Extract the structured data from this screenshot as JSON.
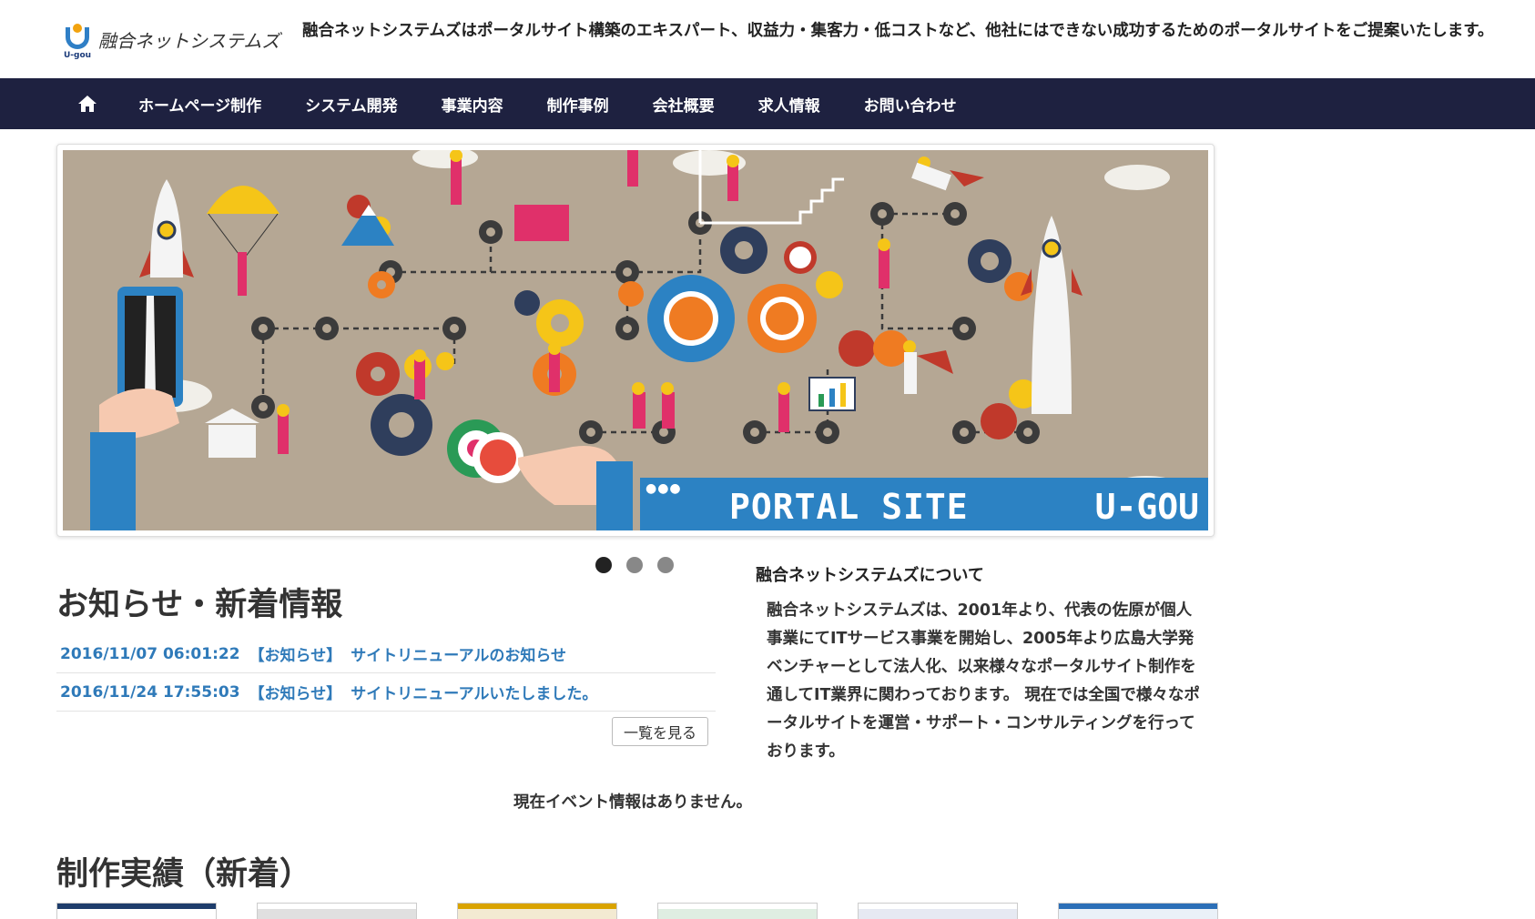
{
  "header": {
    "logo_text": "融合ネットシステムズ",
    "logo_sub": "U-gou",
    "tagline": "融合ネットシステムズはポータルサイト構築のエキスパート、収益力・集客力・低コストなど、他社にはできない成功するためのポータルサイトをご提案いたします。"
  },
  "nav": {
    "home_icon": "home-icon",
    "items": [
      "ホームページ制作",
      "システム開発",
      "事業内容",
      "制作事例",
      "会社概要",
      "求人情報",
      "お問い合わせ"
    ]
  },
  "slider": {
    "banner_title": "PORTAL SITE",
    "banner_brand": "U-GOU",
    "banner_dots": "●●●",
    "slide_count": 3,
    "active_index": 0
  },
  "news": {
    "title": "お知らせ・新着情報",
    "items": [
      {
        "date": "2016/11/07 06:01:22",
        "category": "【お知らせ】",
        "text": "サイトリニューアルのお知らせ"
      },
      {
        "date": "2016/11/24 17:55:03",
        "category": "【お知らせ】",
        "text": "サイトリニューアルいたしました。"
      }
    ],
    "more_label": "一覧を見る"
  },
  "about": {
    "heading": "融合ネットシステムズについて",
    "body": "融合ネットシステムズは、2001年より、代表の佐原が個人事業にてITサービス事業を開始し、2005年より広島大学発ベンチャーとして法人化、以来様々なポータルサイト制作を通してIT業界に関わっております。 現在では全国で様々なポータルサイトを運営・サポート・コンサルティングを行っております。"
  },
  "events": {
    "empty_text": "現在イベント情報はありません。"
  },
  "works": {
    "title": "制作実績（新着）",
    "thumb_count": 6
  },
  "colors": {
    "nav_bg": "#1e2140",
    "link": "#2f7ab9",
    "slide_bg": "#b5a794",
    "banner": "#2c82c3",
    "accent_pink": "#e0306a",
    "accent_yellow": "#f5c518",
    "accent_orange": "#ef7b22",
    "gear_dark": "#3b3b3b"
  }
}
